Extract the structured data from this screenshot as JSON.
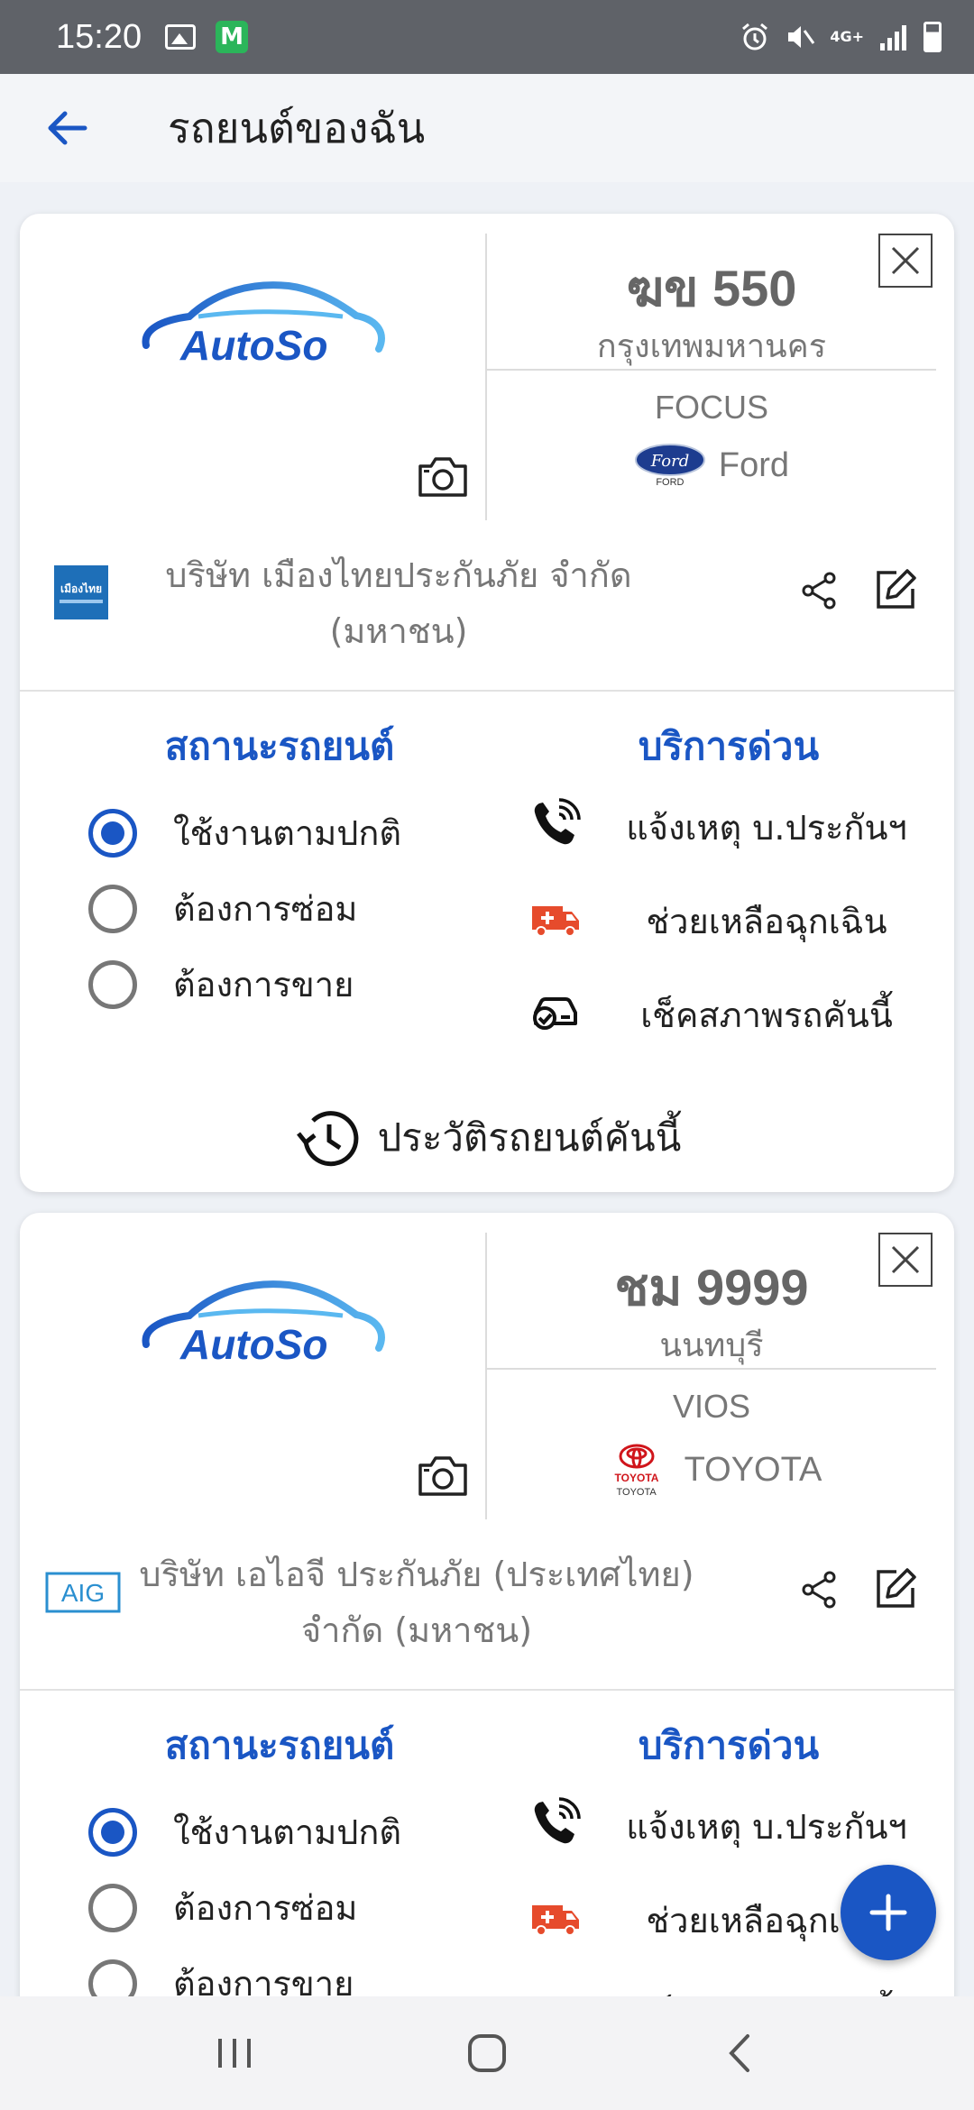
{
  "status_bar": {
    "time": "15:20",
    "network": "4G+"
  },
  "header": {
    "title": "รถยนต์ของฉัน"
  },
  "cars": [
    {
      "plate": "ฆข 550",
      "province": "กรุงเทพมหานคร",
      "model": "FOCUS",
      "brand": "Ford",
      "brand_logo_caption": "FORD",
      "brand_logo_text": "Ford",
      "app_logo_text": "AutoSo",
      "insurer_line1": "บริษัท เมืองไทยประกันภัย จำกัด",
      "insurer_line2": "(มหาชน)",
      "insurer_logo_text": "เมืองไทย"
    },
    {
      "plate": "ชม 9999",
      "province": "นนทบุรี",
      "model": "VIOS",
      "brand": "TOYOTA",
      "brand_logo_caption": "TOYOTA",
      "brand_logo_text": "TOYOTA",
      "app_logo_text": "AutoSo",
      "insurer_line1": "บริษัท เอไอจี ประกันภัย (ประเทศไทย)",
      "insurer_line2": "จำกัด (มหาชน)",
      "insurer_logo_text": "AIG"
    }
  ],
  "status_section": {
    "title": "สถานะรถยนต์",
    "options": [
      "ใช้งานตามปกติ",
      "ต้องการซ่อม",
      "ต้องการขาย"
    ],
    "selected": 0
  },
  "service_section": {
    "title": "บริการด่วน",
    "items": [
      {
        "label": "แจ้งเหตุ บ.ประกันฯ",
        "icon": "phone-call-icon"
      },
      {
        "label": "ช่วยเหลือฉุกเฉิน",
        "icon": "ambulance-icon"
      },
      {
        "label": "เช็คสภาพรถคันนี้",
        "icon": "car-check-icon"
      }
    ]
  },
  "history_label": "ประวัติรถยนต์คันนี้",
  "colors": {
    "accent": "#1a56c4",
    "statusbar": "#5f6268"
  }
}
